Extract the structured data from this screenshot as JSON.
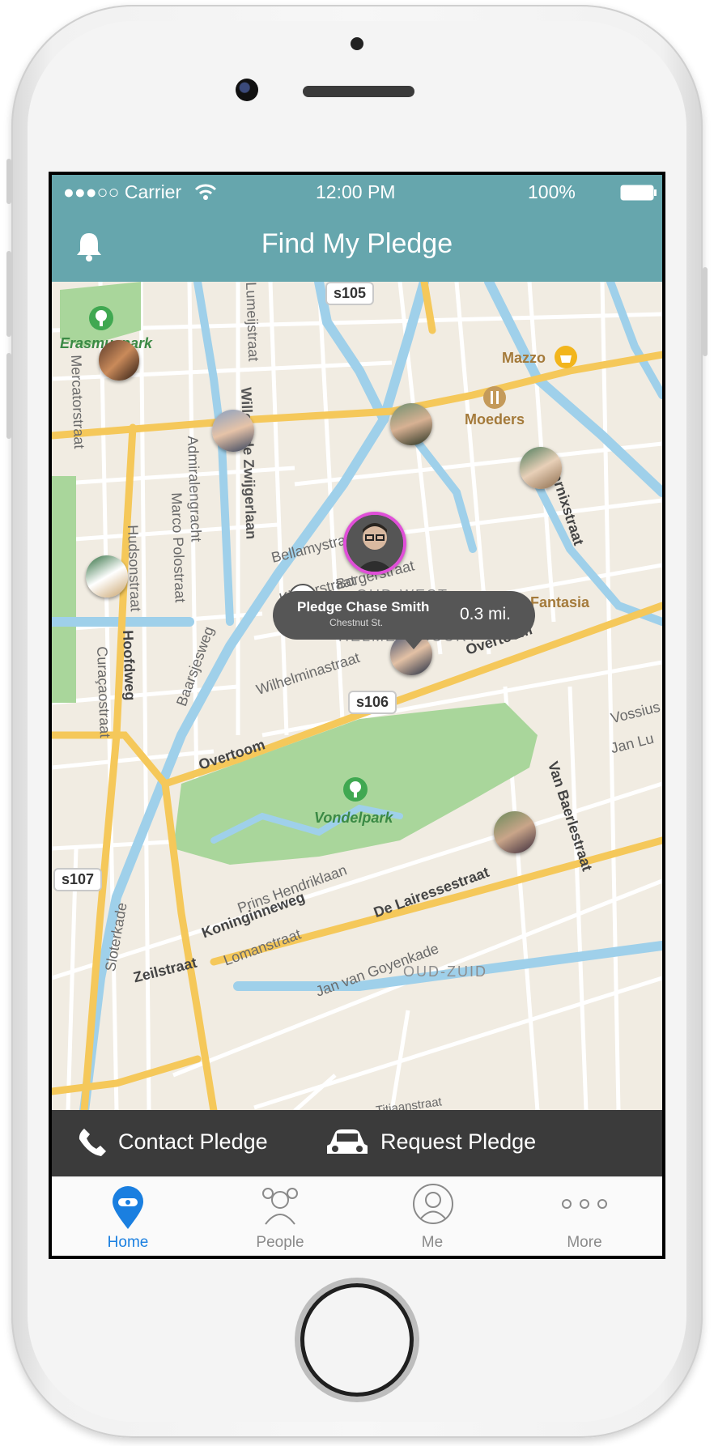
{
  "status_bar": {
    "carrier": "●●●○○ Carrier",
    "time": "12:00 PM",
    "battery": "100%"
  },
  "nav": {
    "title": "Find My Pledge",
    "left_icon": "bell-icon"
  },
  "callout": {
    "name": "Pledge Chase Smith",
    "street": "Chestnut St.",
    "distance": "0.3 mi."
  },
  "map": {
    "road_shields": [
      "s105",
      "s106",
      "s107"
    ],
    "parks": [
      "Erasmuspark",
      "Vondelpark"
    ],
    "places": [
      "Mazzo",
      "Moeders",
      "Trattoria Fantasia"
    ],
    "districts": [
      "OUD-WEST",
      "HELMERSBUURT",
      "OUD-ZUID"
    ],
    "streets": [
      "Willem de Zwijgerlaan",
      "Mercatorstraat",
      "Admiralengracht",
      "Marco Polostraat",
      "Hudsonstraat",
      "Bellamystraat",
      "Kinkerstraat",
      "Borgerstraat",
      "Wilhelminastraat",
      "Overtoom",
      "Hoofdweg",
      "Curaçaostraat",
      "Baarsjesweg",
      "Marnixstraat",
      "Van Baerlestraat",
      "Prins Hendriklaan",
      "Koninginneweg",
      "De Lairessestraat",
      "Lomanstraat",
      "Jan van Goyenkade",
      "Zeilstraat",
      "Sloterkade",
      "Titiaanstraat",
      "Lumeijstraat",
      "Vossius",
      "Jan Lu"
    ]
  },
  "actions": {
    "contact": "Contact Pledge",
    "request": "Request Pledge"
  },
  "tabs": [
    {
      "label": "Home",
      "icon": "home-pin-icon"
    },
    {
      "label": "People",
      "icon": "people-icon"
    },
    {
      "label": "Me",
      "icon": "me-icon"
    },
    {
      "label": "More",
      "icon": "more-icon"
    }
  ],
  "colors": {
    "header": "#66a6ad",
    "active_tab": "#1a7fe0",
    "selected_ring": "#e04fd8"
  }
}
